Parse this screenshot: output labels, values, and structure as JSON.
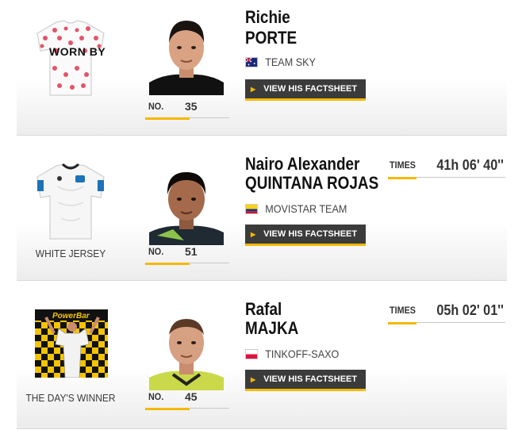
{
  "riders": [
    {
      "first_name": "Richie",
      "last_name": "PORTE",
      "team": "TEAM SKY",
      "flag": "australia-flag",
      "no_label": "NO.",
      "number": "35",
      "factsheet_label": "VIEW HIS FACTSHEET",
      "jersey_overlay": "WORN BY",
      "jersey_icon": "polka-dot-jersey-icon"
    },
    {
      "first_name": "Nairo Alexander",
      "last_name": "QUINTANA ROJAS",
      "team": "MOVISTAR TEAM",
      "flag": "colombia-flag",
      "no_label": "NO.",
      "number": "51",
      "factsheet_label": "VIEW HIS FACTSHEET",
      "jersey_label": "WHITE JERSEY",
      "jersey_icon": "white-jersey-icon",
      "times_label": "TIMES",
      "time": "41h 06' 40''"
    },
    {
      "first_name": "Rafal",
      "last_name": "MAJKA",
      "team": "TINKOFF-SAXO",
      "flag": "poland-flag",
      "no_label": "NO.",
      "number": "45",
      "factsheet_label": "VIEW HIS FACTSHEET",
      "jersey_label": "THE DAY'S WINNER",
      "jersey_icon": "podium-winner-icon",
      "banner_text": "PowerBar",
      "times_label": "TIMES",
      "time": "05h 02' 01''"
    }
  ],
  "colors": {
    "accent": "#f5b800",
    "button_bg": "#3b3b3b",
    "polka_dot": "#e2364e"
  }
}
